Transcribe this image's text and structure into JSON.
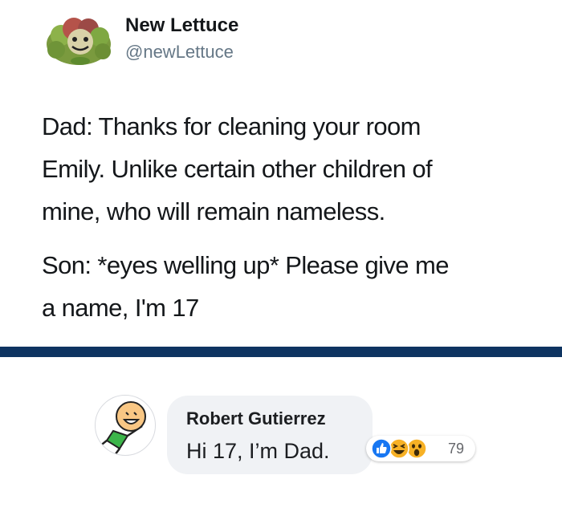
{
  "tweet": {
    "display_name": "New Lettuce",
    "handle": "@newLettuce",
    "paragraph_1": "Dad: Thanks for cleaning your room\nEmily. Unlike certain other children of\nmine, who will remain nameless.",
    "paragraph_2": "Son: *eyes welling up* Please give me\na name, I'm 17",
    "avatar_icon": "lettuce-head-icon"
  },
  "divider_color": "#0e3461",
  "facebook_comment": {
    "author": "Robert Gutierrez",
    "text": "Hi 17, I’m Dad.",
    "avatar_icon": "cartoon-stick-figure-icon",
    "reactions": {
      "icons": [
        "like-reaction-icon",
        "haha-reaction-icon",
        "wow-reaction-icon"
      ],
      "count": "79"
    },
    "colors": {
      "bubble": "#f0f2f5",
      "like": "#1877f2",
      "emoji": "#f7b125"
    }
  }
}
